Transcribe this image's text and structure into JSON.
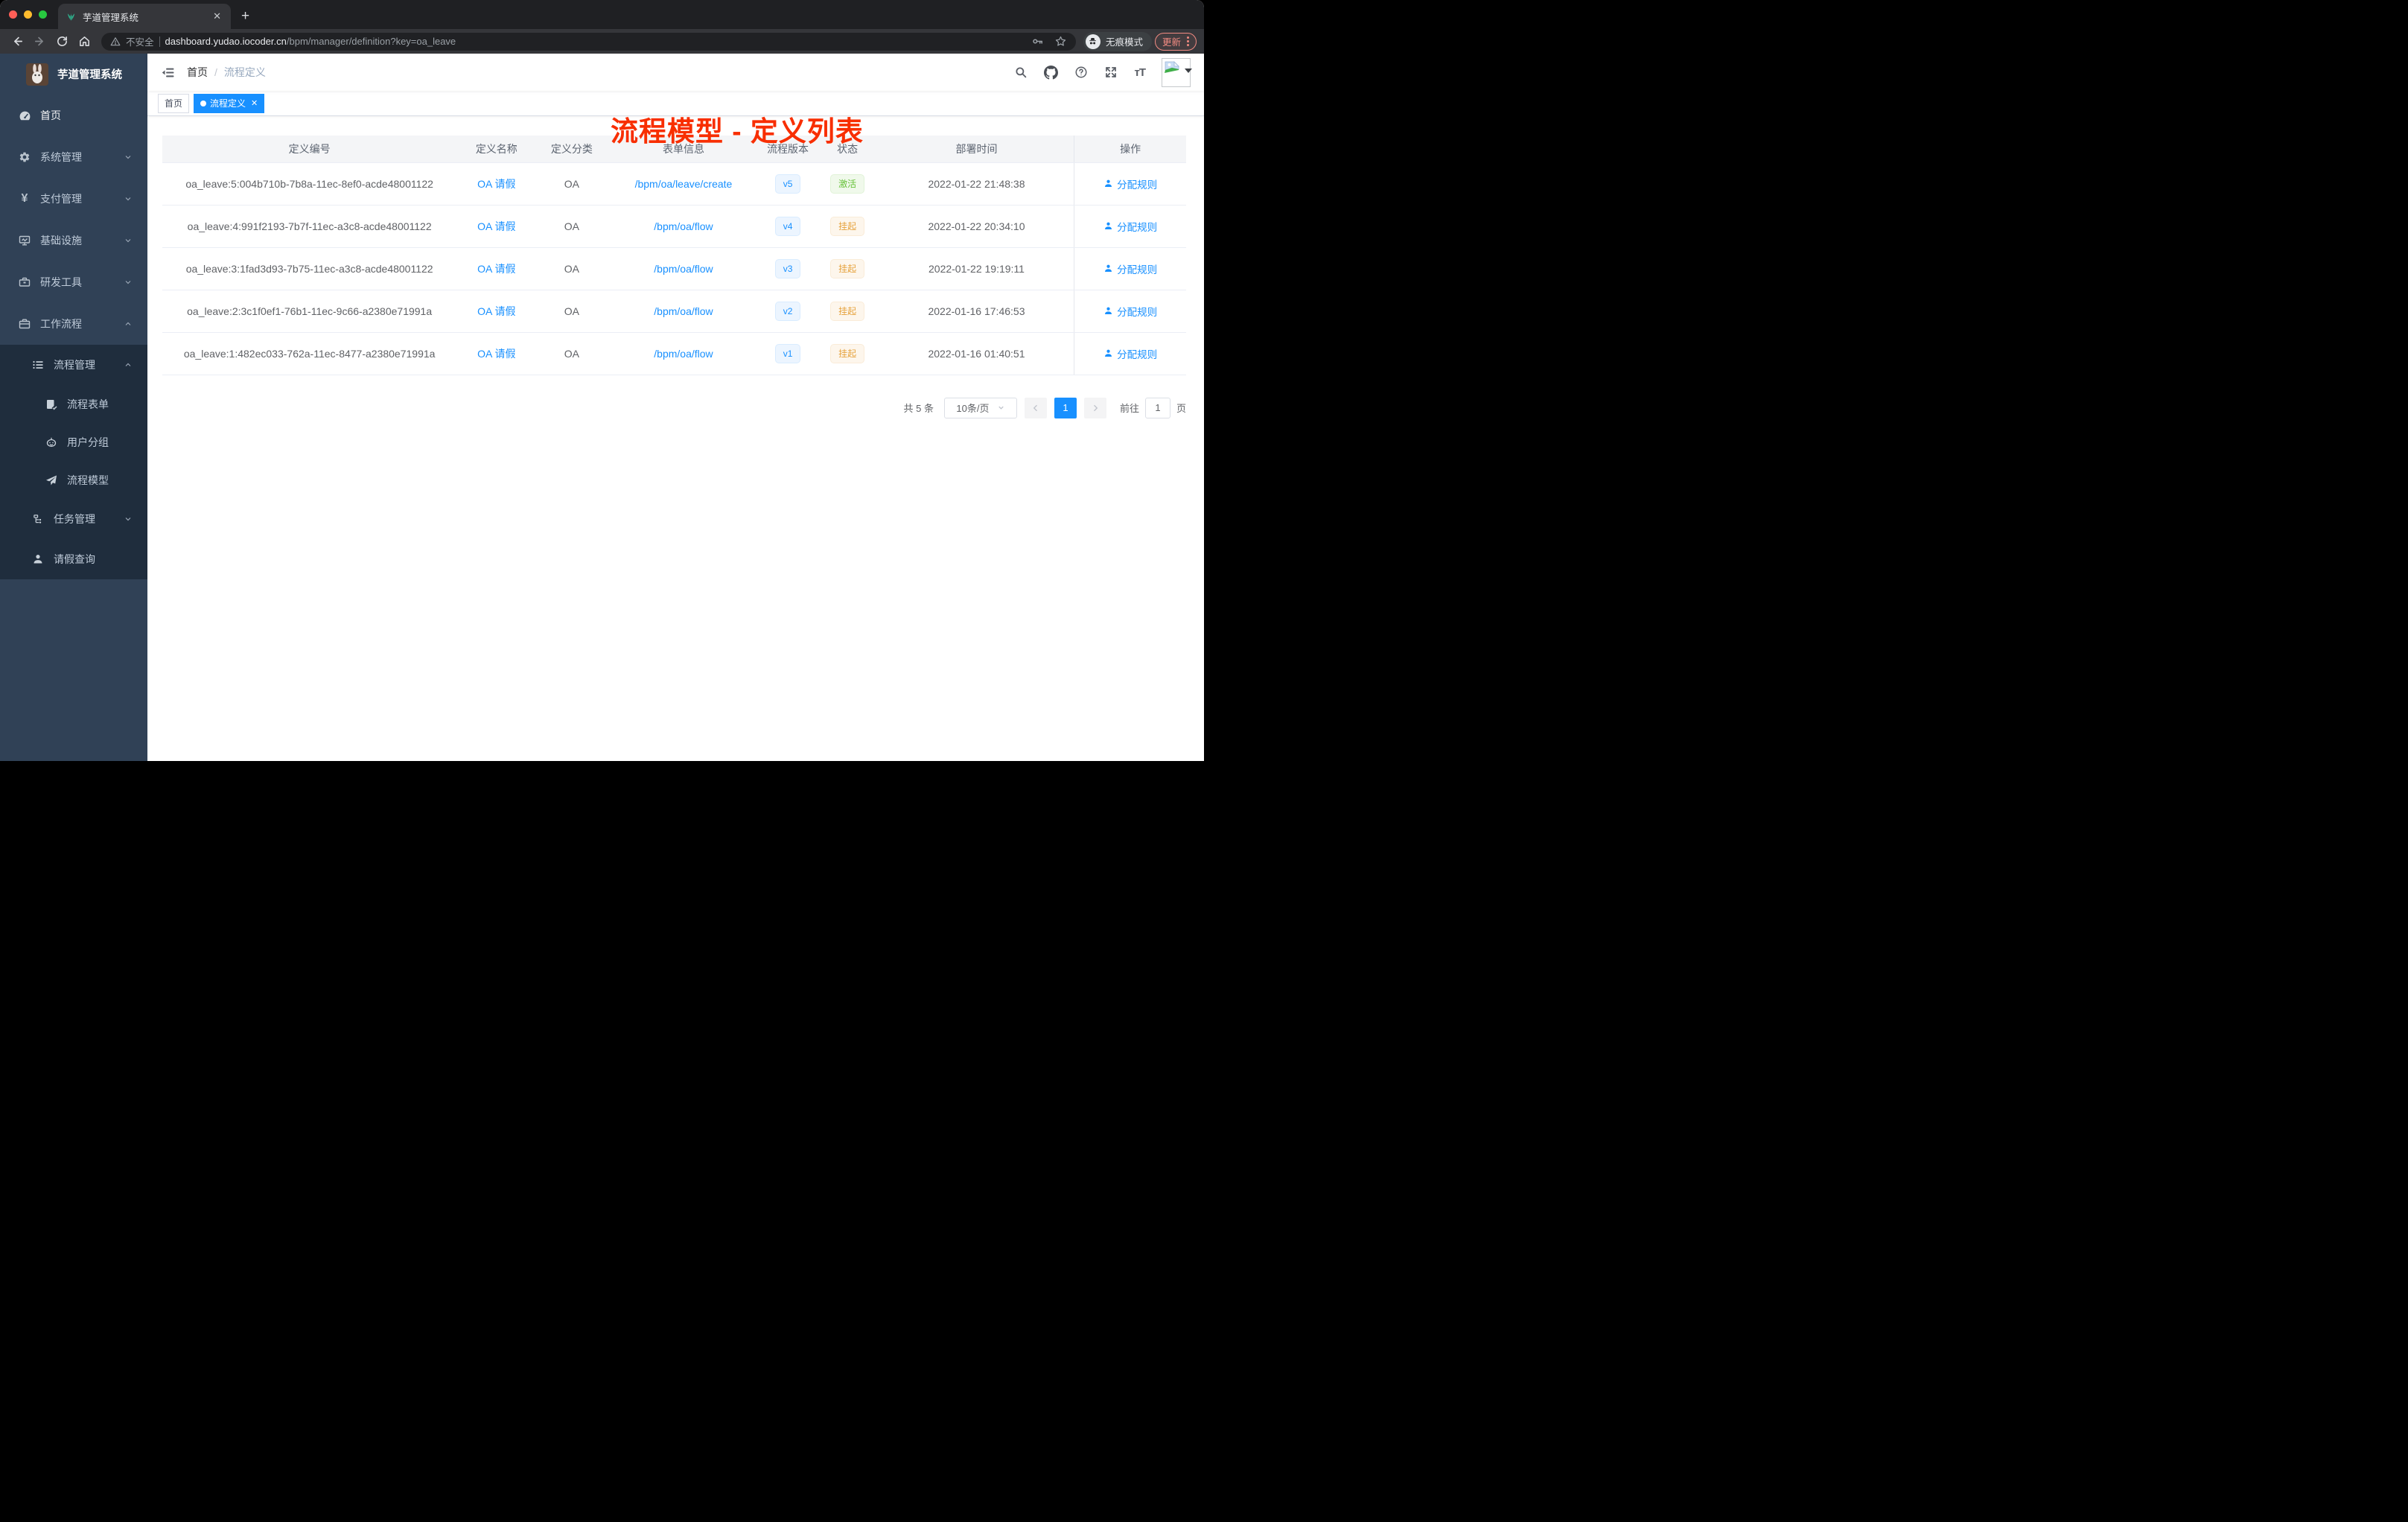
{
  "colors": {
    "accent": "#1890ff",
    "sidebar_bg": "#304156",
    "submenu_bg": "#1f2d3d",
    "success": "#67c23a",
    "warning": "#e6a23c",
    "annotation_red": "#f82e00",
    "update_chip": "#f28b82"
  },
  "browser": {
    "tab_title": "芋道管理系统",
    "security_label": "不安全",
    "url_host": "dashboard.yudao.iocoder.cn",
    "url_path": "/bpm/manager/definition?key=oa_leave",
    "incognito_label": "无痕模式",
    "update_label": "更新"
  },
  "sidebar": {
    "logo_title": "芋道管理系统",
    "items": [
      {
        "label": "首页",
        "icon": "dashboard-icon"
      },
      {
        "label": "系统管理",
        "icon": "gear-icon"
      },
      {
        "label": "支付管理",
        "icon": "yen-icon"
      },
      {
        "label": "基础设施",
        "icon": "monitor-icon"
      },
      {
        "label": "研发工具",
        "icon": "toolbox-icon"
      },
      {
        "label": "工作流程",
        "icon": "briefcase-icon",
        "expanded": true
      }
    ],
    "submenu": {
      "group_label": "流程管理",
      "children": [
        {
          "label": "流程表单",
          "icon": "form-icon"
        },
        {
          "label": "用户分组",
          "icon": "robot-icon"
        },
        {
          "label": "流程模型",
          "icon": "paper-plane-icon"
        }
      ],
      "siblings": [
        {
          "label": "任务管理",
          "icon": "tree-icon"
        },
        {
          "label": "请假查询",
          "icon": "user-icon"
        }
      ]
    }
  },
  "header": {
    "breadcrumb_home": "首页",
    "breadcrumb_sep": "/",
    "breadcrumb_current": "流程定义",
    "annotation": "流程模型 - 定义列表"
  },
  "tags": {
    "home": "首页",
    "current": "流程定义"
  },
  "table": {
    "columns": [
      "定义编号",
      "定义名称",
      "定义分类",
      "表单信息",
      "流程版本",
      "状态",
      "部署时间",
      "操作"
    ],
    "action_label": "分配规则",
    "rows": [
      {
        "id": "oa_leave:5:004b710b-7b8a-11ec-8ef0-acde48001122",
        "name": "OA 请假",
        "category": "OA",
        "form": "/bpm/oa/leave/create",
        "version": "v5",
        "status": "激活",
        "status_type": "success",
        "time": "2022-01-22 21:48:38"
      },
      {
        "id": "oa_leave:4:991f2193-7b7f-11ec-a3c8-acde48001122",
        "name": "OA 请假",
        "category": "OA",
        "form": "/bpm/oa/flow",
        "version": "v4",
        "status": "挂起",
        "status_type": "warning",
        "time": "2022-01-22 20:34:10"
      },
      {
        "id": "oa_leave:3:1fad3d93-7b75-11ec-a3c8-acde48001122",
        "name": "OA 请假",
        "category": "OA",
        "form": "/bpm/oa/flow",
        "version": "v3",
        "status": "挂起",
        "status_type": "warning",
        "time": "2022-01-22 19:19:11"
      },
      {
        "id": "oa_leave:2:3c1f0ef1-76b1-11ec-9c66-a2380e71991a",
        "name": "OA 请假",
        "category": "OA",
        "form": "/bpm/oa/flow",
        "version": "v2",
        "status": "挂起",
        "status_type": "warning",
        "time": "2022-01-16 17:46:53"
      },
      {
        "id": "oa_leave:1:482ec033-762a-11ec-8477-a2380e71991a",
        "name": "OA 请假",
        "category": "OA",
        "form": "/bpm/oa/flow",
        "version": "v1",
        "status": "挂起",
        "status_type": "warning",
        "time": "2022-01-16 01:40:51"
      }
    ]
  },
  "pagination": {
    "total": "共 5 条",
    "page_size": "10条/页",
    "current_page": "1",
    "goto_label": "前往",
    "goto_value": "1",
    "page_unit": "页"
  }
}
